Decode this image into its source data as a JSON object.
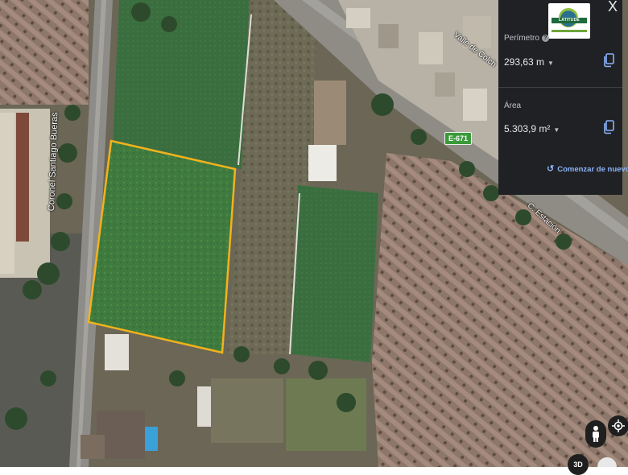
{
  "map": {
    "roads": {
      "main": "Coronel Santiago Bueras",
      "valle": "Valle de Colch",
      "estacion": "C. Estación"
    },
    "route_badge": "E-671"
  },
  "panel": {
    "close": "X",
    "logo_text": "LATITUDE",
    "perimeter": {
      "label": "Perímetro",
      "value": "293,63 m",
      "help": "?"
    },
    "area": {
      "label": "Área",
      "value": "5.303,9 m²"
    },
    "restart": "Comenzar de nuevo",
    "icons": {
      "close": "close-icon",
      "help": "help-icon",
      "copy": "copy-icon",
      "restart": "restart-icon"
    }
  },
  "controls": {
    "three_d": "3D",
    "icons": [
      "pegman-icon",
      "my-location-icon",
      "compass-icon"
    ]
  },
  "colors": {
    "panel_bg": "#202124",
    "accent": "#8ab4f8",
    "polygon": "#f2b21c"
  }
}
